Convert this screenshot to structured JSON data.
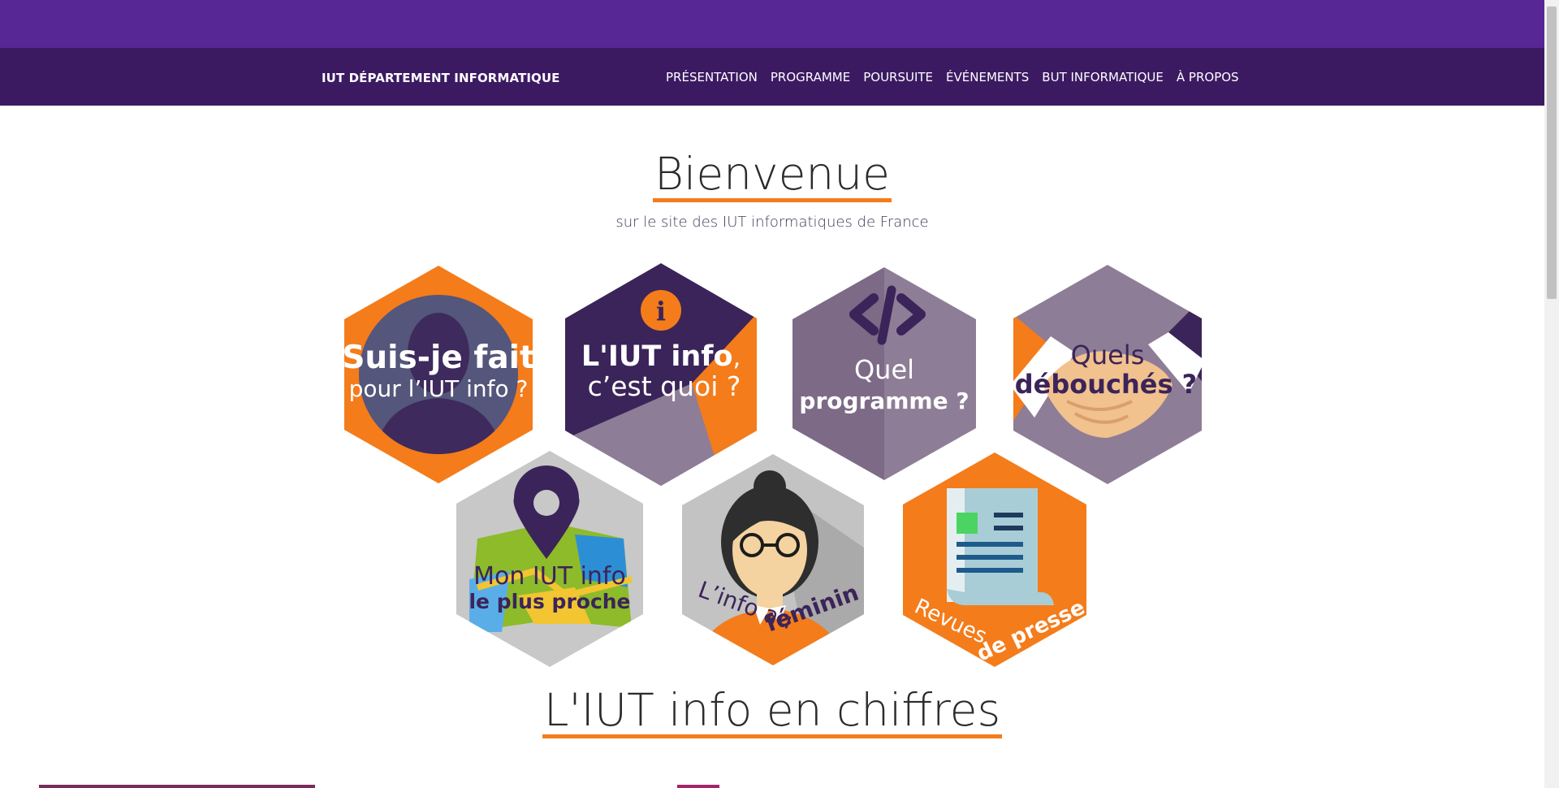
{
  "nav": {
    "brand": "IUT DÉPARTEMENT INFORMATIQUE",
    "items": [
      "PRÉSENTATION",
      "PROGRAMME",
      "POURSUITE",
      "ÉVÉNEMENTS",
      "BUT INFORMATIQUE",
      "À PROPOS"
    ]
  },
  "hero": {
    "title": "Bienvenue",
    "subtitle": "sur le site des IUT informatiques de France"
  },
  "tiles": {
    "suis": {
      "line1": "Suis-je fait",
      "line2": "pour l’IUT info ?"
    },
    "iut": {
      "line1": "L'IUT info",
      "comma": ",",
      "line2": "c’est quoi ?"
    },
    "programme": {
      "line1": "Quel",
      "line2": "programme ?"
    },
    "debouches": {
      "line1": "Quels",
      "line2": "débouchés ?"
    },
    "proche": {
      "line1": "Mon IUT info",
      "line2": "le plus proche"
    },
    "feminin": {
      "line1": "L’info au",
      "line2": "féminin"
    },
    "presse": {
      "line1": "Revues",
      "line2": "de presse"
    }
  },
  "section2": {
    "title": "L'IUT info en chiffres"
  },
  "colors": {
    "purple": "#572795",
    "dark_purple": "#3c1a62",
    "orange": "#f47c1a",
    "mauve": "#8e7d96"
  },
  "icons": [
    "user-silhouette-icon",
    "info-icon",
    "code-icon",
    "handshake-icon",
    "map-pin-icon",
    "woman-avatar-icon",
    "newspaper-icon"
  ]
}
